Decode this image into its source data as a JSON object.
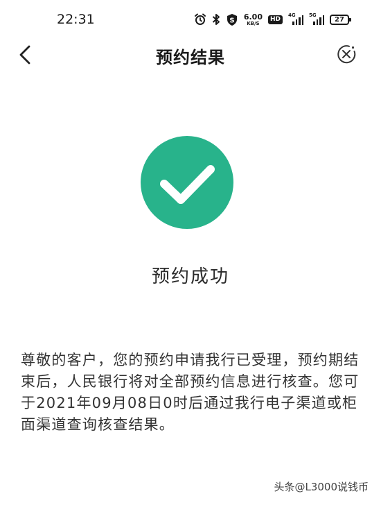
{
  "status_bar": {
    "time": "22:31",
    "speed_value": "6.00",
    "speed_unit": "KB/S",
    "hd_label": "HD",
    "sim1_tag": "4G",
    "sim2_tag": "5G",
    "battery": "27"
  },
  "nav": {
    "title": "预约结果"
  },
  "result": {
    "status_text": "预约成功",
    "icon_color": "#28b38b"
  },
  "notice": {
    "text": "尊敬的客户，您的预约申请我行已受理，预约期结束后，人民银行将对全部预约信息进行核查。您可于2021年09月08日0时后通过我行电子渠道或柜面渠道查询核查结果。"
  },
  "watermark": {
    "text": "头条@L3000说钱币"
  }
}
